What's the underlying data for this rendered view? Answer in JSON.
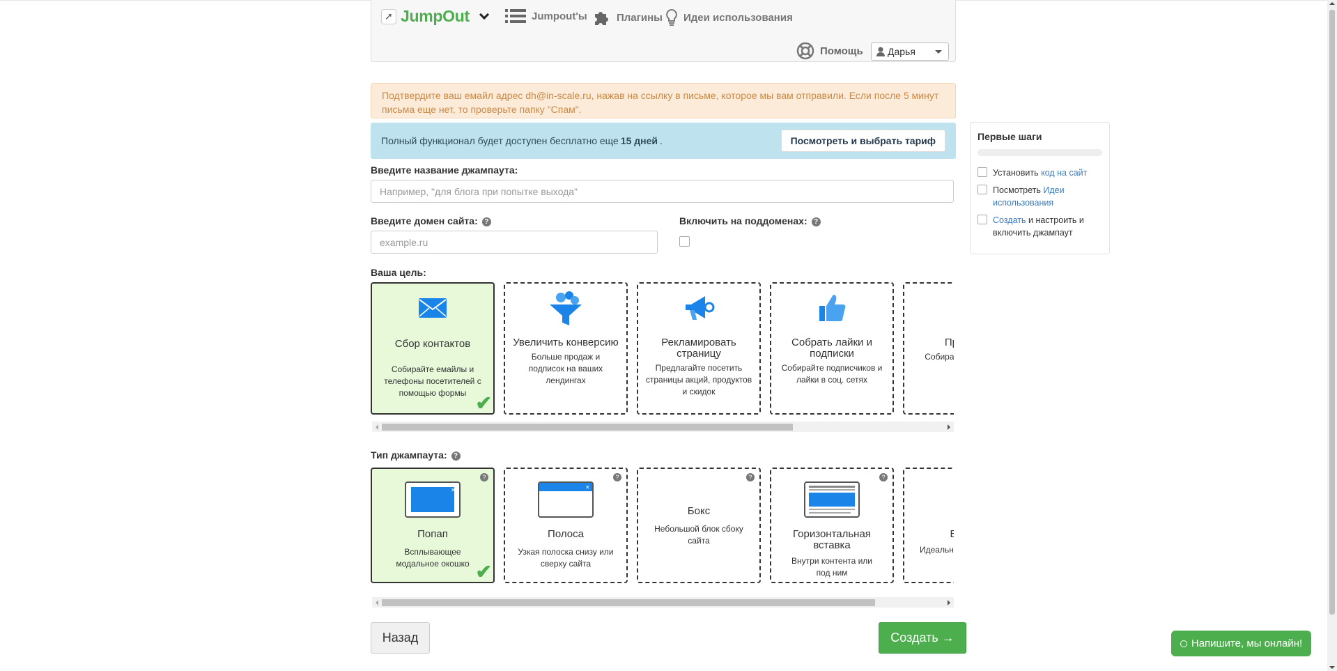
{
  "header": {
    "logo_text": "JumpOut",
    "logo_icon": "arrow-icon",
    "nav": [
      {
        "label": "Jumpout'ы",
        "icon": "list-icon"
      },
      {
        "label": "Плагины",
        "icon": "puzzle-icon"
      },
      {
        "label": "Идеи использования",
        "icon": "lightbulb-icon"
      }
    ],
    "help_label": "Помощь",
    "user_name": "Дарья"
  },
  "alerts": {
    "confirm_email": "Подтвердите ваш емайл адрес dh@in-scale.ru, нажав на ссылку в письме, которое мы вам отправили. Если после 5 минут письма еще нет, то проверьте папку \"Спам\".",
    "trial_prefix": "Полный функционал будет доступен бесплатно еще",
    "trial_days": "15 дней",
    "trial_suffix": ".",
    "tariff_button": "Посмотреть и выбрать тариф"
  },
  "form": {
    "name_label": "Введите название джампаута:",
    "name_placeholder": "Например, \"для блога при попытке выхода\"",
    "domain_label": "Введите домен сайта:",
    "domain_placeholder": "example.ru",
    "subdomains_label": "Включить на поддоменах:",
    "goal_label": "Ваша цель:",
    "type_label": "Тип джампаута:"
  },
  "goals": [
    {
      "title": "Сбор контактов",
      "desc": "Собирайте емайлы и телефоны посетителей с помощью формы",
      "icon": "envelope-icon",
      "selected": true
    },
    {
      "title": "Увеличить конверсию",
      "desc": "Больше продаж и подписок на ваших лендингах",
      "icon": "funnel-icon",
      "selected": false
    },
    {
      "title": "Рекламировать страницу",
      "desc": "Предлагайте посетить страницы акций, продуктов и скидок",
      "icon": "megaphone-icon",
      "selected": false
    },
    {
      "title": "Собрать лайки и подписки",
      "desc": "Собирайте подписчиков и лайки в соц. сетях",
      "icon": "thumbs-up-icon",
      "selected": false
    },
    {
      "title": "Пред... поз...",
      "desc": "Собира... предлага... з...",
      "icon": "partial-icon",
      "selected": false
    }
  ],
  "goals_scroll_fraction": 0.6,
  "types": [
    {
      "title": "Попап",
      "desc": "Всплывающее модальное окошко",
      "icon": "popup-icon",
      "selected": true
    },
    {
      "title": "Полоса",
      "desc": "Узкая полоска снизу или сверху сайта",
      "icon": "bar-icon",
      "selected": false
    },
    {
      "title": "Бокс",
      "desc": "Небольшой блок сбоку сайта",
      "icon": "",
      "selected": false
    },
    {
      "title": "Горизонтальная вставка",
      "desc": "Внутри контента или под ним",
      "icon": "inline-icon",
      "selected": false
    },
    {
      "title": "Верт... во...",
      "desc": "Идеальн...",
      "icon": "vertical-icon",
      "selected": false
    }
  ],
  "types_scroll_fraction": 0.68,
  "buttons": {
    "back": "Назад",
    "create": "Создать →"
  },
  "side_panel": {
    "title": "Первые шаги",
    "items": [
      {
        "text": "Установить",
        "link": "код на сайт",
        "after": ""
      },
      {
        "text": "Посмотреть",
        "link": "Идеи использования",
        "after": ""
      },
      {
        "text": "",
        "link": "Создать",
        "after": "и настроить и включить джампаут"
      }
    ]
  },
  "chat": {
    "label": "Напишите, мы онлайн!"
  },
  "colors": {
    "brand_green": "#4cae4c",
    "info_bg": "#bfe3ee",
    "warn_bg": "#fcebd9",
    "link": "#3a7bbf"
  }
}
